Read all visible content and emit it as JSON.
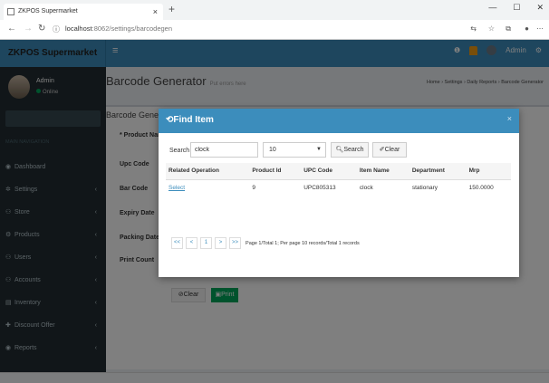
{
  "browser": {
    "tab_title": "ZKPOS Supermarket",
    "tab_close": "×",
    "new_tab": "+",
    "url_host": "localhost",
    "url_path": ":8062/settings/barcodegen"
  },
  "app": {
    "brand": "ZKPOS Supermarket",
    "hamburger": "≡",
    "user_name": "Admin",
    "user_status": "Online",
    "top_user": "Admin"
  },
  "sidebar": {
    "header": "MAIN NAVIGATION",
    "items": [
      {
        "label": "Dashboard",
        "icon": "◉",
        "caret": ""
      },
      {
        "label": "Settings",
        "icon": "✲",
        "caret": "‹"
      },
      {
        "label": "Store",
        "icon": "⚇",
        "caret": "‹"
      },
      {
        "label": "Products",
        "icon": "⚙",
        "caret": "‹"
      },
      {
        "label": "Users",
        "icon": "⚇",
        "caret": "‹"
      },
      {
        "label": "Accounts",
        "icon": "⚇",
        "caret": "‹"
      },
      {
        "label": "Inventory",
        "icon": "▤",
        "caret": "‹"
      },
      {
        "label": "Discount Offer",
        "icon": "✚",
        "caret": "‹"
      },
      {
        "label": "Reports",
        "icon": "◉",
        "caret": "‹"
      }
    ]
  },
  "page": {
    "title": "Barcode Generator",
    "subtitle": "Put errors here",
    "breadcrumb": "Home › Settings › Daily Reports › Barcode Generator",
    "box_title": "Barcode Generat",
    "fields": [
      "* Product Nam",
      "Upc Code",
      "Bar Code",
      "Expiry Date",
      "Packing Date",
      "Print Count"
    ],
    "clear_btn": "Clear",
    "print_btn": "Print"
  },
  "modal": {
    "title": "Find Item",
    "close": "×",
    "search_label": "Search",
    "search_value": "clock",
    "page_size": "10",
    "search_btn": "Search",
    "clear_btn": "Clear",
    "columns": [
      "Related Operation",
      "Product Id",
      "UPC Code",
      "Item Name",
      "Department",
      "Mrp"
    ],
    "rows": [
      [
        "Select",
        "9",
        "UPC805313",
        "clock",
        "stationary",
        "150.0000"
      ]
    ],
    "pager": [
      "<<",
      "<",
      "1",
      ">",
      ">>"
    ],
    "pager_info": "Page 1/Total 1; Per page 10 records/Total 1 records"
  }
}
